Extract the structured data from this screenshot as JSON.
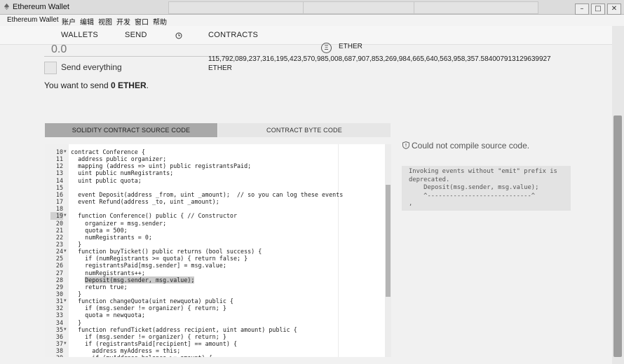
{
  "window": {
    "title": "Ethereum Wallet",
    "controls": [
      "–",
      "□",
      "✕"
    ]
  },
  "menu": [
    "Ethereum Wallet",
    "账户",
    "编辑",
    "视图",
    "开发",
    "窗口",
    "帮助"
  ],
  "nav": {
    "wallets": "WALLETS",
    "send": "SEND",
    "contracts": "CONTRACTS"
  },
  "send_form": {
    "amount_placeholder": "0.0",
    "currency_unit": "ETHER",
    "balance": "115,792,089,237,316,195,423,570,985,008,687,907,853,269,984,665,640,563,958,357.584007913129639927",
    "balance_unit": "ETHER",
    "send_everything": "Send everything",
    "summary_prefix": "You want to send ",
    "summary_amount": "0 ETHER",
    "summary_suffix": "."
  },
  "editor_tabs": {
    "source": "SOLIDITY CONTRACT SOURCE CODE",
    "bytecode": "CONTRACT BYTE CODE"
  },
  "code_lines": [
    {
      "n": "10",
      "fold": true,
      "text": "contract Conference {"
    },
    {
      "n": "11",
      "fold": false,
      "text": "  address public organizer;"
    },
    {
      "n": "12",
      "fold": false,
      "text": "  mapping (address => uint) public registrantsPaid;"
    },
    {
      "n": "13",
      "fold": false,
      "text": "  uint public numRegistrants;"
    },
    {
      "n": "14",
      "fold": false,
      "text": "  uint public quota;"
    },
    {
      "n": "15",
      "fold": false,
      "text": ""
    },
    {
      "n": "16",
      "fold": false,
      "text": "  event Deposit(address _from, uint _amount);  // so you can log these events"
    },
    {
      "n": "17",
      "fold": false,
      "text": "  event Refund(address _to, uint _amount);"
    },
    {
      "n": "18",
      "fold": false,
      "text": ""
    },
    {
      "n": "19",
      "fold": true,
      "text": "  function Conference() public { // Constructor"
    },
    {
      "n": "20",
      "fold": false,
      "text": "    organizer = msg.sender;"
    },
    {
      "n": "21",
      "fold": false,
      "text": "    quota = 500;"
    },
    {
      "n": "22",
      "fold": false,
      "text": "    numRegistrants = 0;"
    },
    {
      "n": "23",
      "fold": false,
      "text": "  }"
    },
    {
      "n": "24",
      "fold": true,
      "text": "  function buyTicket() public returns (bool success) {"
    },
    {
      "n": "25",
      "fold": false,
      "text": "    if (numRegistrants >= quota) { return false; }"
    },
    {
      "n": "26",
      "fold": false,
      "text": "    registrantsPaid[msg.sender] = msg.value;"
    },
    {
      "n": "27",
      "fold": false,
      "text": "    numRegistrants++;"
    },
    {
      "n": "28",
      "fold": false,
      "text": "    Deposit(msg.sender, msg.value);"
    },
    {
      "n": "29",
      "fold": false,
      "text": "    return true;"
    },
    {
      "n": "30",
      "fold": false,
      "text": "  }"
    },
    {
      "n": "31",
      "fold": true,
      "text": "  function changeQuota(uint newquota) public {"
    },
    {
      "n": "32",
      "fold": false,
      "text": "    if (msg.sender != organizer) { return; }"
    },
    {
      "n": "33",
      "fold": false,
      "text": "    quota = newquota;"
    },
    {
      "n": "34",
      "fold": false,
      "text": "  }"
    },
    {
      "n": "35",
      "fold": true,
      "text": "  function refundTicket(address recipient, uint amount) public {"
    },
    {
      "n": "36",
      "fold": false,
      "text": "    if (msg.sender != organizer) { return; }"
    },
    {
      "n": "37",
      "fold": true,
      "text": "    if (registrantsPaid[recipient] == amount) {"
    },
    {
      "n": "38",
      "fold": false,
      "text": "      address myAddress = this;"
    },
    {
      "n": "39",
      "fold": false,
      "text": "      if (myAddress.balance >= amount) {"
    }
  ],
  "compile": {
    "error_title": "Could not compile source code.",
    "error_detail": "Invoking events without \"emit\" prefix is\ndeprecated.\n    Deposit(msg.sender, msg.value);\n    ^----------------------------^\n,"
  }
}
